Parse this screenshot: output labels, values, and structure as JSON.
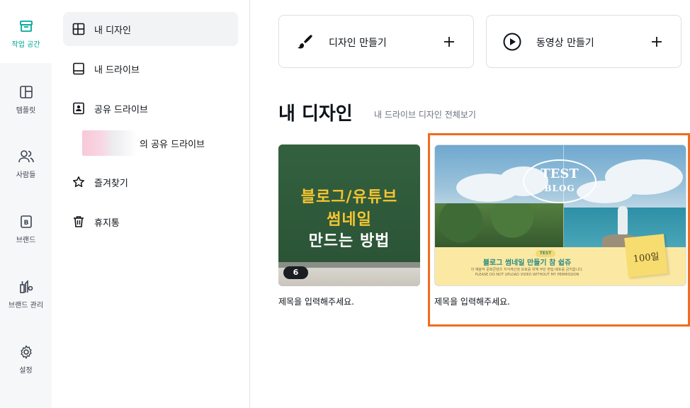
{
  "rail": {
    "items": [
      {
        "label": "작업 공간",
        "icon": "workspace-icon",
        "active": true
      },
      {
        "label": "템플릿",
        "icon": "template-icon"
      },
      {
        "label": "사람들",
        "icon": "people-icon"
      },
      {
        "label": "브랜드",
        "icon": "brand-icon"
      },
      {
        "label": "브랜드 관리",
        "icon": "brand-manage-icon"
      },
      {
        "label": "설정",
        "icon": "gear-icon"
      }
    ]
  },
  "nav": {
    "items": [
      {
        "label": "내 디자인",
        "icon": "layout-icon",
        "selected": true
      },
      {
        "label": "내 드라이브",
        "icon": "drive-icon"
      },
      {
        "label": "공유 드라이브",
        "icon": "shared-drive-icon"
      },
      {
        "label": "의 공유 드라이브",
        "icon": "none"
      },
      {
        "label": "즐겨찾기",
        "icon": "star-icon"
      },
      {
        "label": "휴지통",
        "icon": "trash-icon"
      }
    ]
  },
  "create": {
    "design_label": "디자인 만들기",
    "video_label": "동영상 만들기"
  },
  "section": {
    "title": "내 디자인",
    "view_all": "내 드라이브 디자인 전체보기"
  },
  "cards": [
    {
      "title": "제목을 입력해주세요.",
      "page_count": "6",
      "thumb_lines": [
        "블로그/유튜브",
        "썸네일",
        "만드는 방법"
      ]
    },
    {
      "title": "제목을 입력해주세요.",
      "thumb_oval_1": "TEST",
      "thumb_oval_2": "BLOG",
      "thumb_tag": "TEST",
      "thumb_banner": "블로그 썸네일 만들기 참 쉽쥬",
      "thumb_sub1": "이 예술적 문화콘텐츠 지식재산권 보호를 위해 무단 편집·배포를 금지합니다.",
      "thumb_sub2": "PLEASE DO NOT UPLOAD VIDEO WITHOUT MY PERMISSION",
      "thumb_sticky": "100일"
    }
  ],
  "colors": {
    "accent": "#00a79d",
    "highlight": "#f26b1d"
  }
}
